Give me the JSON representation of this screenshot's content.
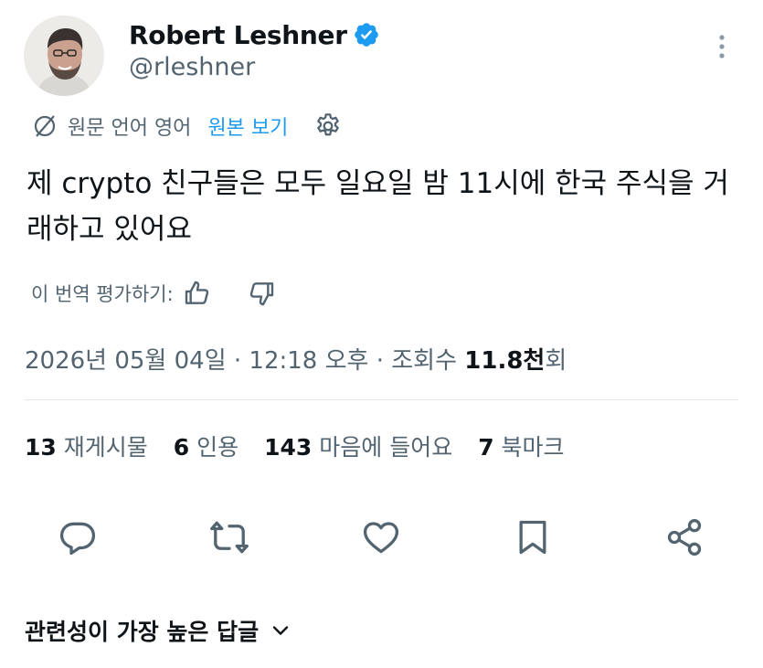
{
  "author": {
    "name": "Robert Leshner",
    "handle": "@rleshner"
  },
  "translation": {
    "label": "원문 언어 영어",
    "view_original": "원본 보기"
  },
  "tweet": {
    "text": "제 crypto 친구들은 모두 일요일 밤 11시에 한국 주식을 거래하고 있어요"
  },
  "rate": {
    "label": "이 번역 평가하기:"
  },
  "meta": {
    "timestamp": "2026년 05월 04일 · 12:18 오후 · 조회수 ",
    "views_value": "11.8천",
    "views_suffix": "회"
  },
  "stats": {
    "reposts_count": "13",
    "reposts_label": " 재게시물",
    "quotes_count": "6",
    "quotes_label": " 인용",
    "likes_count": "143",
    "likes_label": " 마음에 들어요",
    "bookmarks_count": "7",
    "bookmarks_label": " 북마크"
  },
  "replies": {
    "sort_label": "관련성이 가장 높은 답글"
  },
  "colors": {
    "accent": "#1d9bf0",
    "text_primary": "#0f1419",
    "text_secondary": "#536471",
    "divider": "#e4e8eb"
  },
  "icons": [
    "verified-badge-icon",
    "more-vertical-icon",
    "translate-icon",
    "gear-icon",
    "thumbs-up-icon",
    "thumbs-down-icon",
    "reply-icon",
    "repost-icon",
    "like-icon",
    "bookmark-icon",
    "share-icon",
    "chevron-down-icon"
  ]
}
